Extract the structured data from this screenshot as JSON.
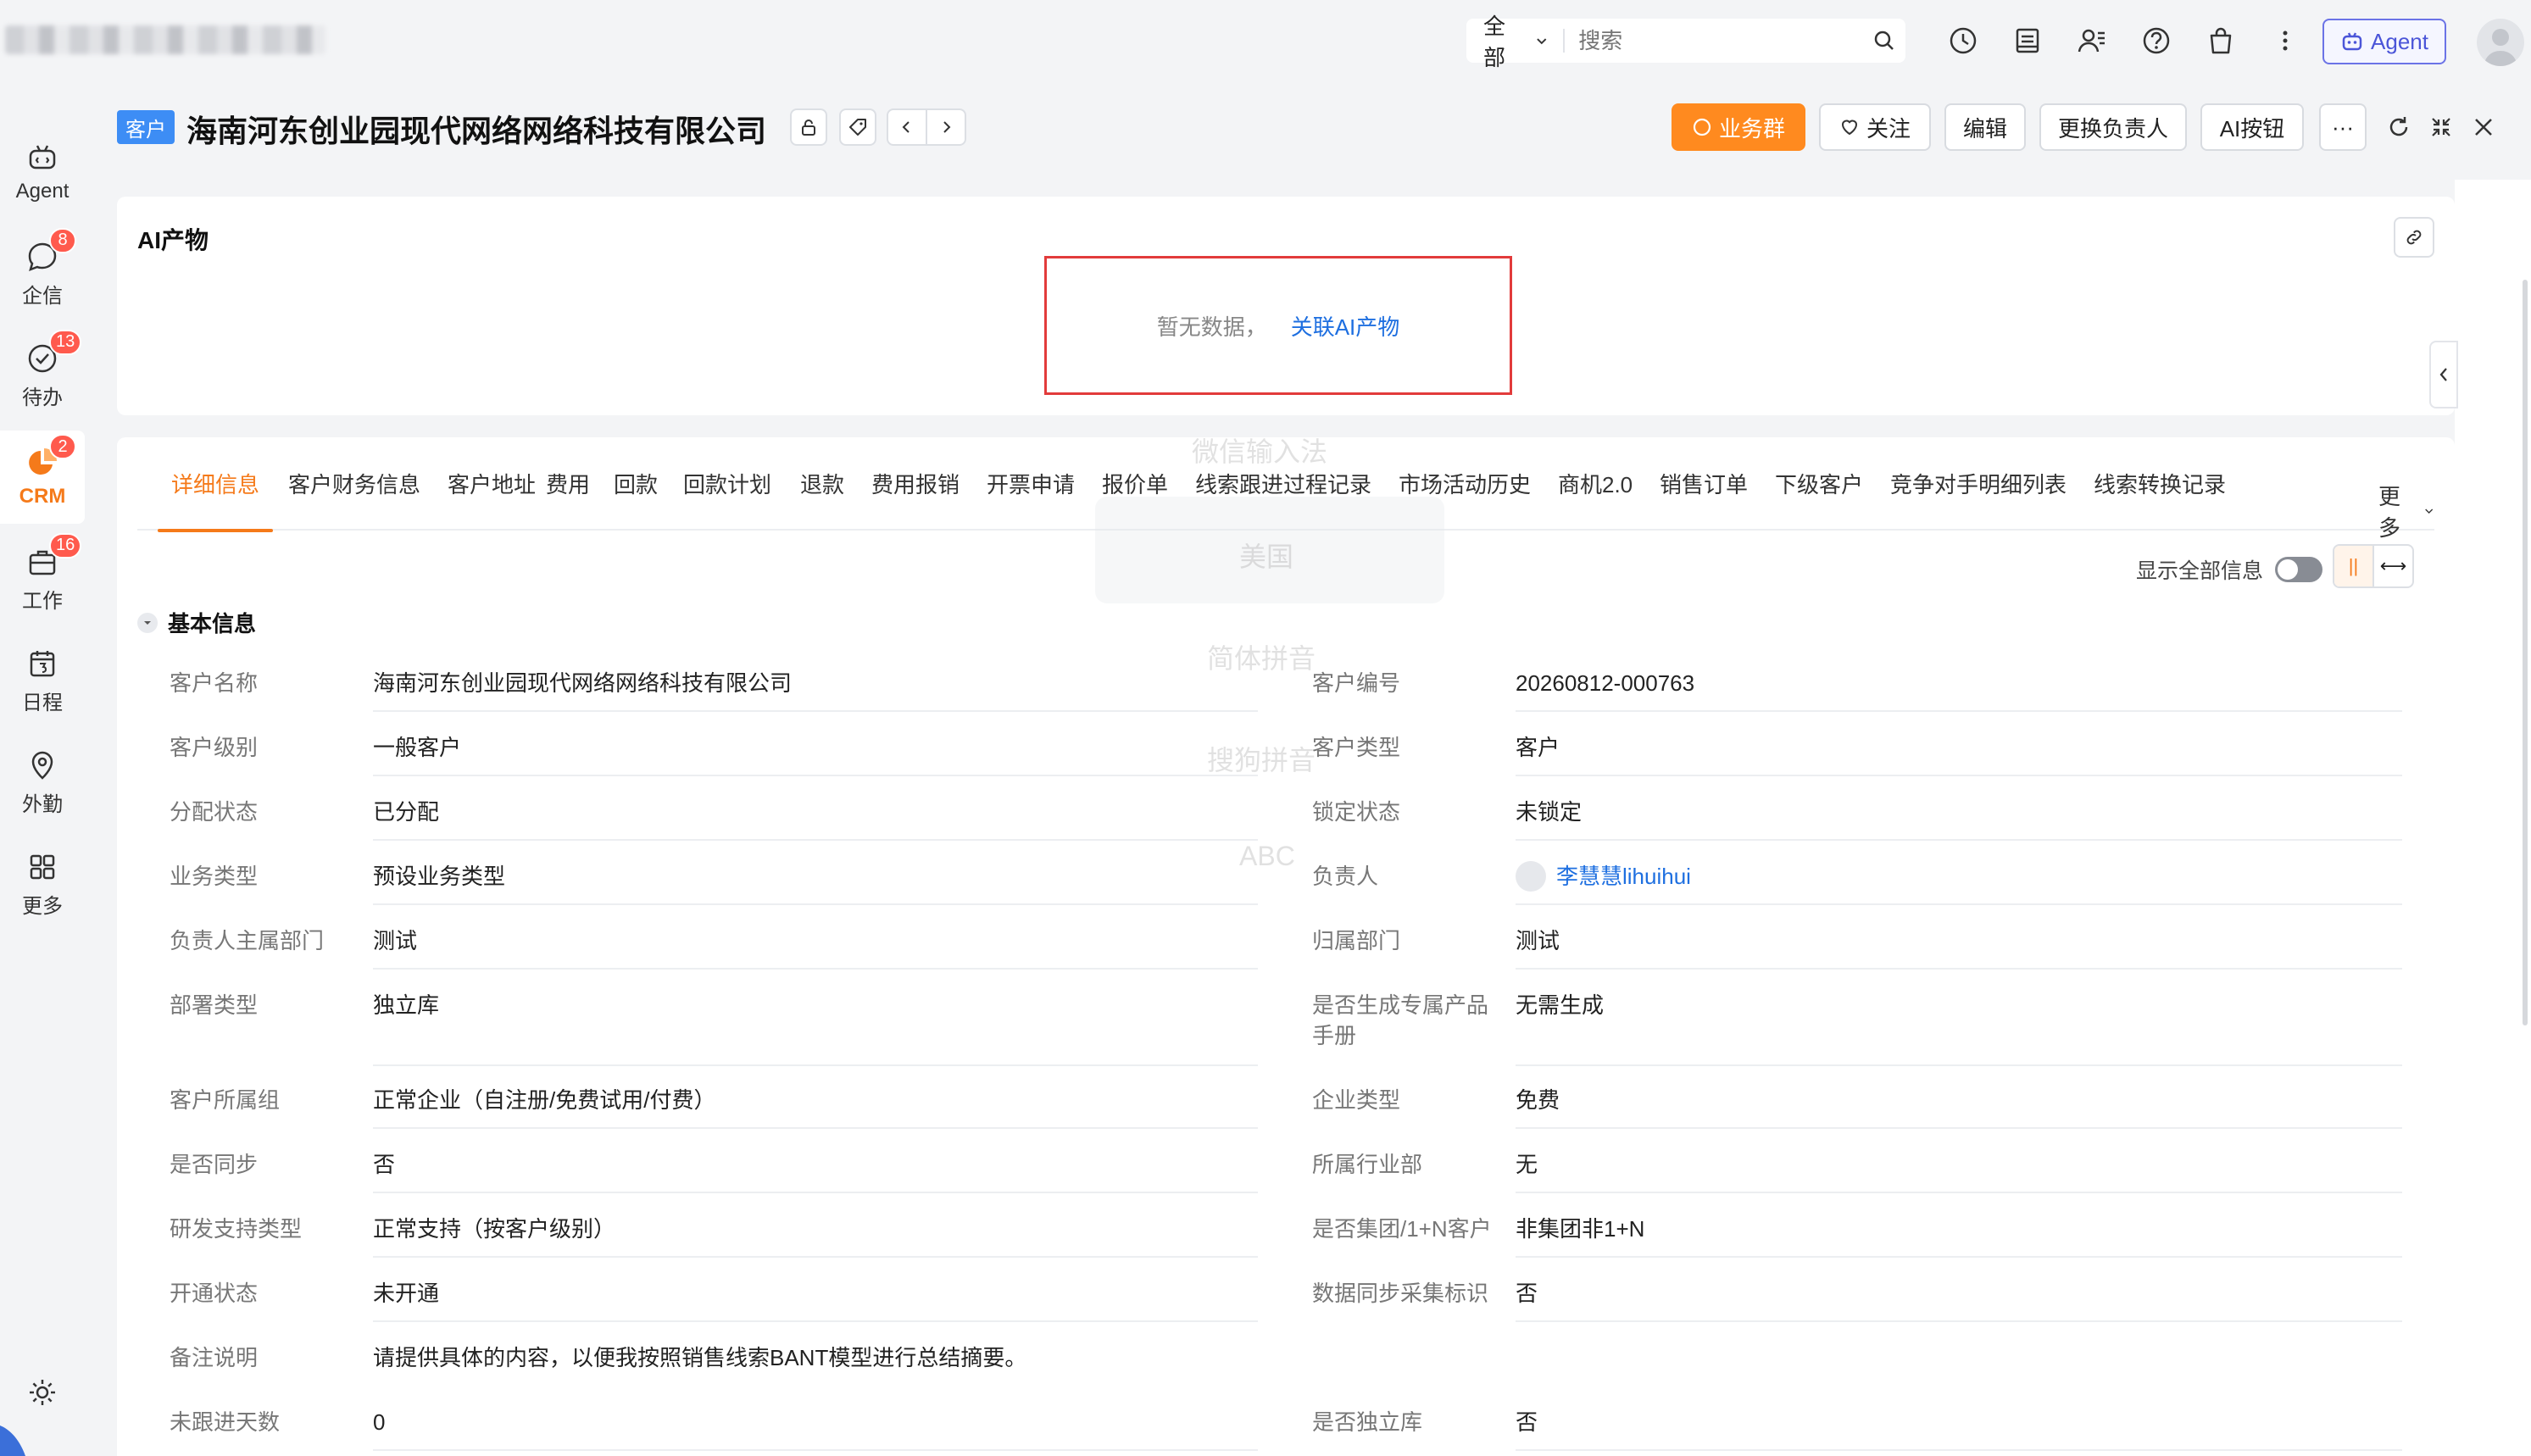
{
  "topbar": {
    "search_scope": "全部",
    "search_placeholder": "搜索",
    "agent_label": "Agent"
  },
  "sidebar": {
    "items": [
      {
        "label": "Agent",
        "badge": ""
      },
      {
        "label": "企信",
        "badge": "8"
      },
      {
        "label": "待办",
        "badge": "13"
      },
      {
        "label": "CRM",
        "badge": "2"
      },
      {
        "label": "工作",
        "badge": "16"
      },
      {
        "label": "日程",
        "badge": ""
      },
      {
        "label": "外勤",
        "badge": ""
      },
      {
        "label": "更多",
        "badge": ""
      }
    ]
  },
  "header": {
    "tag": "客户",
    "title": "海南河东创业园现代网络网络科技有限公司",
    "buttons": {
      "business_group": "业务群",
      "follow": "关注",
      "edit": "编辑",
      "change_owner": "更换负责人",
      "ai_button": "AI按钮",
      "more": "···"
    }
  },
  "ai_card": {
    "title": "AI产物",
    "empty_text": "暂无数据，",
    "link_text": "关联AI产物"
  },
  "tabs": {
    "items": [
      "详细信息",
      "客户财务信息",
      "客户地址",
      "费用",
      "回款",
      "回款计划",
      "退款",
      "费用报销",
      "开票申请",
      "报价单",
      "线索跟进过程记录",
      "市场活动历史",
      "商机2.0",
      "销售订单",
      "下级客户",
      "竞争对手明细列表",
      "线索转换记录"
    ],
    "more": "更多"
  },
  "ghost_overlay": [
    "微信输入法",
    "美国",
    "简体拼音",
    "搜狗拼音",
    "ABC"
  ],
  "detail": {
    "show_all": "显示全部信息",
    "section_title": "基本信息",
    "left_fields": [
      {
        "label": "客户名称",
        "value": "海南河东创业园现代网络网络科技有限公司"
      },
      {
        "label": "客户级别",
        "value": "一般客户"
      },
      {
        "label": "分配状态",
        "value": "已分配"
      },
      {
        "label": "业务类型",
        "value": "预设业务类型"
      },
      {
        "label": "负责人主属部门",
        "value": "测试"
      },
      {
        "label": "部署类型",
        "value": "独立库"
      },
      {
        "label": "客户所属组",
        "value": "正常企业（自注册/免费试用/付费）"
      },
      {
        "label": "是否同步",
        "value": "否"
      },
      {
        "label": "研发支持类型",
        "value": "正常支持（按客户级别）"
      },
      {
        "label": "开通状态",
        "value": "未开通"
      },
      {
        "label": "备注说明",
        "value": "请提供具体的内容，以便我按照销售线索BANT模型进行总结摘要。"
      },
      {
        "label": "未跟进天数",
        "value": "0"
      }
    ],
    "right_fields": [
      {
        "label": "客户编号",
        "value": "20260812-000763"
      },
      {
        "label": "客户类型",
        "value": "客户"
      },
      {
        "label": "锁定状态",
        "value": "未锁定"
      },
      {
        "label": "负责人",
        "value": "李慧慧lihuihui"
      },
      {
        "label": "归属部门",
        "value": "测试"
      },
      {
        "label": "是否生成专属产品",
        "label2": "手册",
        "value": "无需生成"
      },
      {
        "label": "企业类型",
        "value": "免费"
      },
      {
        "label": "所属行业部",
        "value": "无"
      },
      {
        "label": "是否集团/1+N客户",
        "value": "非集团非1+N"
      },
      {
        "label": "数据同步采集标识",
        "value": "否"
      },
      {
        "label": "是否独立库",
        "value": "否"
      }
    ]
  },
  "colors": {
    "accent": "#f57a1a",
    "orange_button": "#ff8a1f",
    "link": "#1e6fe0",
    "badge": "#ff5a4d",
    "highlight_box": "#e23b3b"
  }
}
